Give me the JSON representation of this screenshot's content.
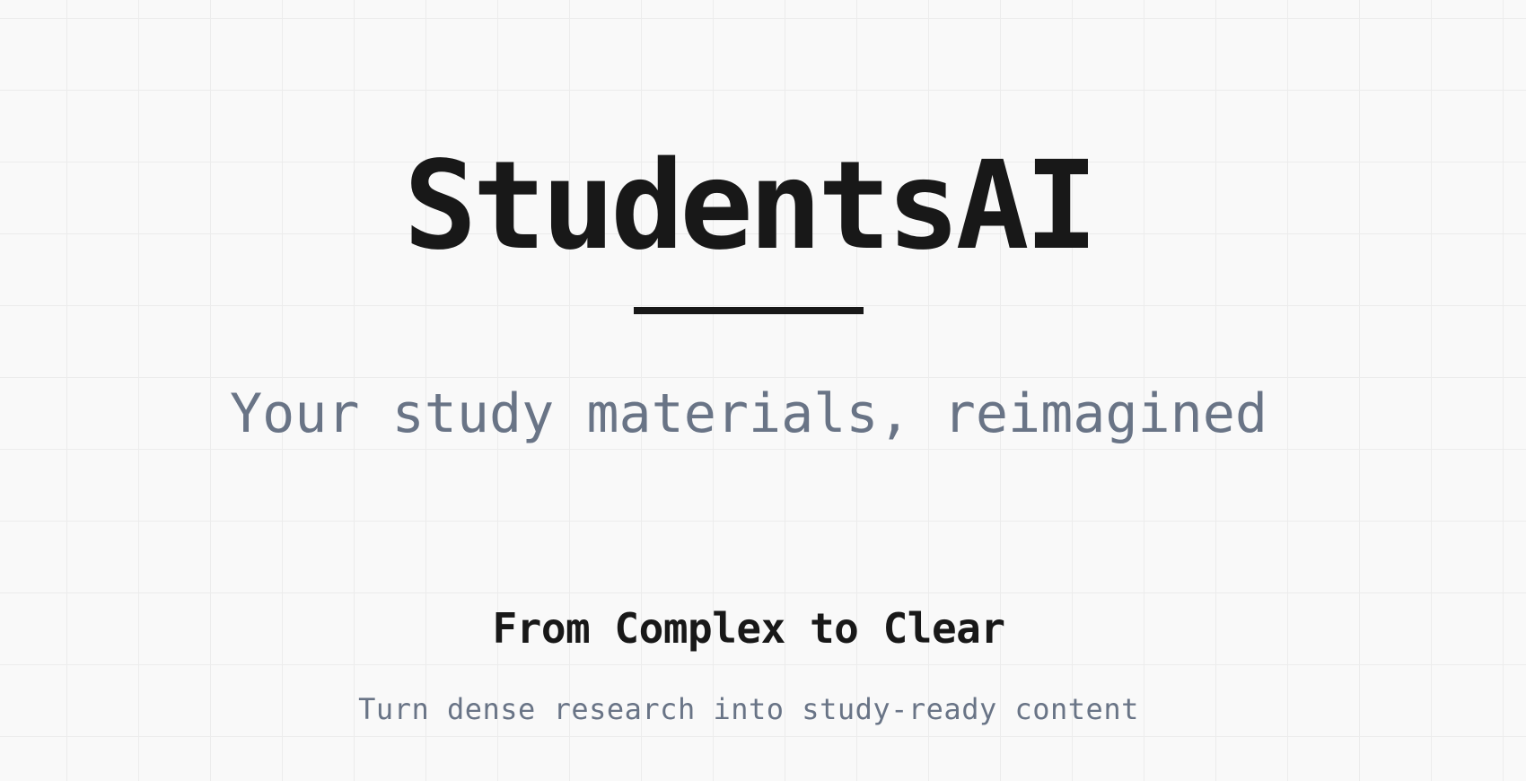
{
  "hero": {
    "title": "StudentsAI",
    "tagline": "Your study materials, reimagined"
  },
  "feature": {
    "title": "From Complex to Clear",
    "subtitle": "Turn dense research into study-ready content"
  },
  "colors": {
    "background": "#f9f9f9",
    "text_primary": "#181818",
    "text_muted": "#697486",
    "grid_line": "#ececec"
  }
}
